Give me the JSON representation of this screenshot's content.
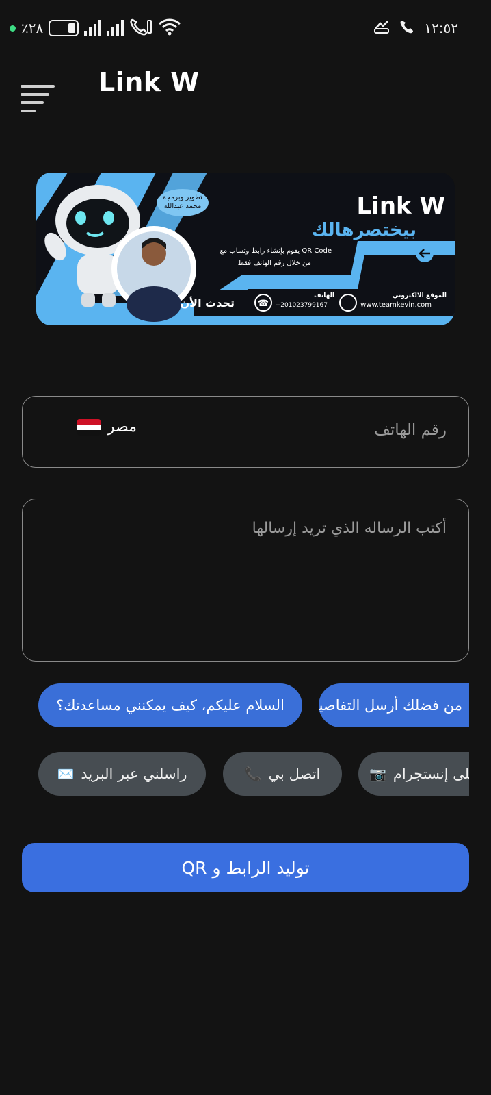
{
  "status_bar": {
    "battery_text": "٪٢٨",
    "battery_level": 0.28,
    "time": "١٢:٥٢"
  },
  "app_bar": {
    "title": "Link W",
    "menu_icon": "menu-icon"
  },
  "banner": {
    "brand": "Link W",
    "headline": "بيختصرهالك",
    "credit_line1": "تطوير وبرمجة",
    "credit_line2": "محمد عبدالله",
    "desc_line1": "يقوم بإنشاء رابط وتساب مع QR Code",
    "desc_line2": "من خلال رقم الهاتف فقط",
    "call_now": "تحدث الأن",
    "phone_label": "الهاتف",
    "phone_number": "+201023799167",
    "website_label": "الموقع الالكتروني",
    "website": "www.teamkevin.com"
  },
  "phone_field": {
    "placeholder": "رقم الهاتف",
    "country": "مصر"
  },
  "message_field": {
    "placeholder": "أكتب الرساله الذي تريد إرسالها"
  },
  "quick_messages": [
    {
      "label": "من فضلك أرسل التفاصيل."
    },
    {
      "label": "السلام عليكم، كيف يمكنني مساعدتك؟"
    }
  ],
  "contact_chips": [
    {
      "label": "تابعني على إنستجرام",
      "icon": "📷"
    },
    {
      "label": "اتصل بي",
      "icon": "📞"
    },
    {
      "label": "راسلني عبر البريد",
      "icon": "✉️"
    }
  ],
  "generate_button": {
    "label": "توليد الرابط و  QR"
  },
  "colors": {
    "background": "#131313",
    "accent_blue": "#3a6fe0",
    "chip_gray": "#474d52",
    "banner_blue": "#5ab4f0"
  }
}
